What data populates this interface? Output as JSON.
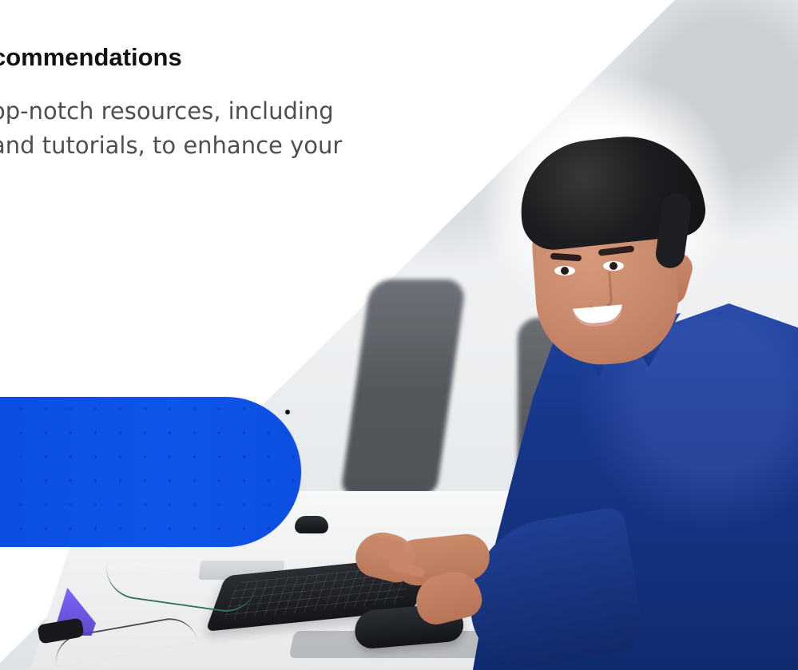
{
  "hero": {
    "headline": "commendations",
    "copy_lines": [
      "op-notch resources, including",
      "and tutorials, to enhance your"
    ]
  },
  "colors": {
    "accent_blue": "#0d52e6",
    "shirt_blue": "#183786",
    "text_dark": "#121212",
    "text_muted": "#4f4f4f"
  },
  "image": {
    "description": "smiling man working at a computer desk"
  }
}
